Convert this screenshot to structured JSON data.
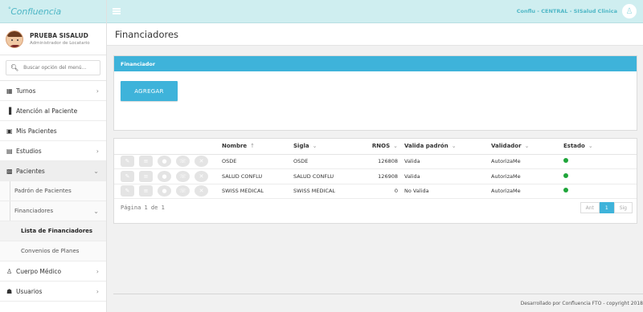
{
  "brand": {
    "name": "Confluencia"
  },
  "user": {
    "name": "PRUEBA SISALUD",
    "role": "Administrador de Locatario"
  },
  "search": {
    "placeholder": "Buscar opción del menú..."
  },
  "topbar": {
    "context": "Conflu - CENTRAL - SISalud Clinica"
  },
  "sidebar": {
    "items": [
      {
        "label": "Turnos",
        "icon": "calendar-icon"
      },
      {
        "label": "Atención al Paciente",
        "icon": "barcode-icon"
      },
      {
        "label": "Mis Pacientes",
        "icon": "users-icon"
      },
      {
        "label": "Estudios",
        "icon": "file-icon"
      },
      {
        "label": "Pacientes",
        "icon": "id-card-icon"
      },
      {
        "label": "Padrón de Pacientes"
      },
      {
        "label": "Financiadores"
      },
      {
        "label": "Lista de Financiadores"
      },
      {
        "label": "Convenios de Planes"
      },
      {
        "label": "Cuerpo Médico",
        "icon": "user-icon"
      },
      {
        "label": "Usuarios",
        "icon": "group-icon"
      }
    ]
  },
  "page": {
    "title": "Financiadores"
  },
  "panel": {
    "title": "Financiador",
    "add_label": "AGREGAR"
  },
  "table": {
    "columns": {
      "nombre": "Nombre",
      "sigla": "Sigla",
      "rnos": "RNOS",
      "valida": "Valida padrón",
      "validador": "Validador",
      "estado": "Estado"
    },
    "rows": [
      {
        "nombre": "OSDE",
        "sigla": "OSDE",
        "rnos": "126808",
        "valida": "Valida",
        "validador": "AutorizaMe"
      },
      {
        "nombre": "SALUD CONFLU",
        "sigla": "SALUD CONFLU",
        "rnos": "126908",
        "valida": "Valida",
        "validador": "AutorizaMe"
      },
      {
        "nombre": "SWISS MEDICAL",
        "sigla": "SWISS MEDICAL",
        "rnos": "0",
        "valida": "No Valida",
        "validador": "AutorizaMe"
      }
    ],
    "status_color": "#1fa53a"
  },
  "pager": {
    "text": "Página 1 de 1",
    "prev": "Ant",
    "current": "1",
    "next": "Sig"
  },
  "footer": {
    "text": "Desarrollado por Confluencia FTO - copyright 2018"
  },
  "colors": {
    "accent": "#3eb3da",
    "topbar": "#cfeef0"
  }
}
